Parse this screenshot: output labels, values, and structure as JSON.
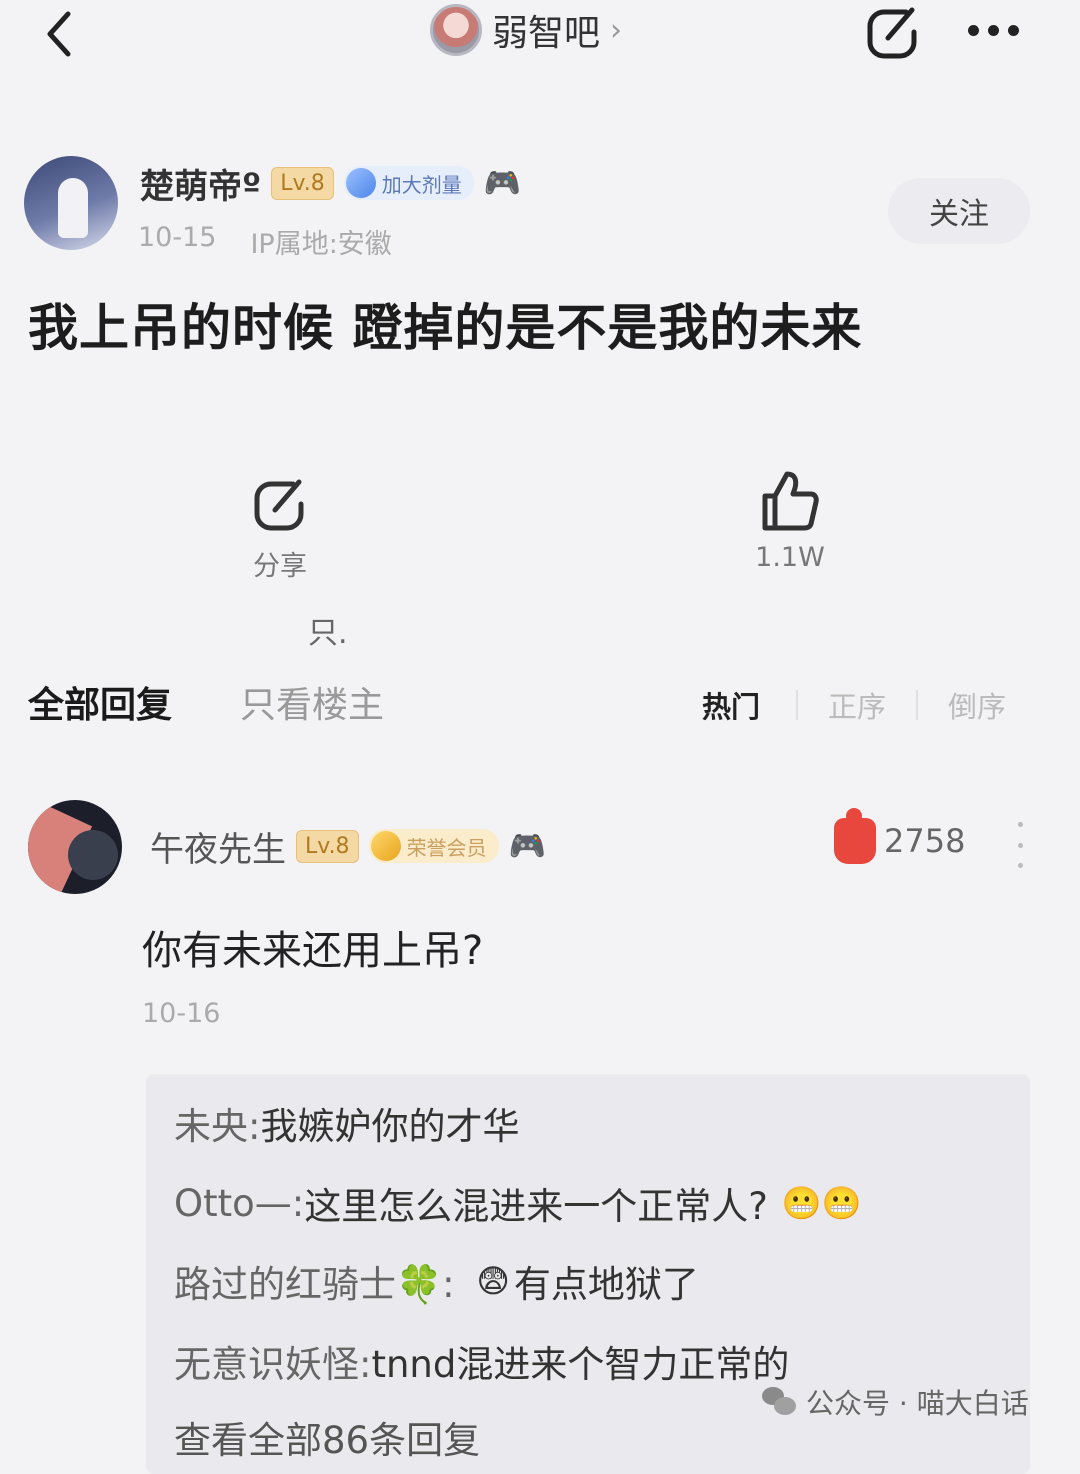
{
  "topbar": {
    "forum_name": "弱智吧",
    "forum_chevron": "›"
  },
  "post": {
    "author": "楚萌帝º",
    "level": "Lv.8",
    "member_badge": "加大剂量",
    "date": "10-15",
    "ip": "IP属地:安徽",
    "follow_label": "关注",
    "title": "我上吊的时候 蹬掉的是不是我的未来",
    "share_label": "分享",
    "like_count": "1.1W",
    "stray": "只."
  },
  "tabs": {
    "all": "全部回复",
    "op_only": "只看楼主",
    "sort_hot": "热门",
    "sort_asc": "正序",
    "sort_desc": "倒序"
  },
  "comment": {
    "author": "午夜先生",
    "level": "Lv.8",
    "member_badge": "荣誉会员",
    "likes": "2758",
    "text": "你有未来还用上吊?",
    "date": "10-16"
  },
  "sub_replies": [
    {
      "name": "未央:",
      "text": "我嫉妒你的才华",
      "emoji_after": ""
    },
    {
      "name": "Otto—:",
      "text": "这里怎么混进来一个正常人?",
      "emoji_after": "😬😬"
    },
    {
      "name": "路过的红骑士🍀:",
      "text": "有点地狱了",
      "emoji_before": "😨"
    },
    {
      "name": "无意识妖怪:",
      "text": "tnnd混进来个智力正常的",
      "emoji_after": ""
    }
  ],
  "view_all": "查看全部86条回复",
  "watermark": {
    "source": "公众号 · 喵大白话"
  },
  "colors": {
    "like_red": "#e8473e",
    "badge_gold": "#f5d9a4",
    "background": "#f3f3f5"
  }
}
